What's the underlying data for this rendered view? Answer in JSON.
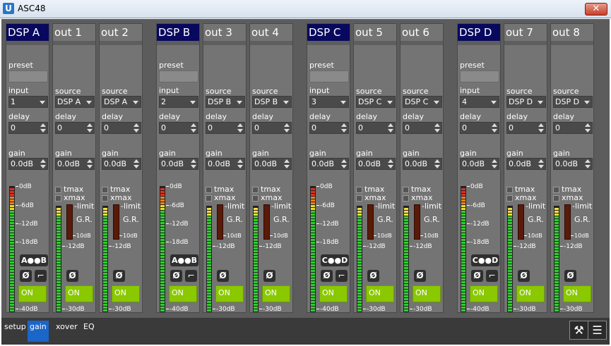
{
  "window": {
    "title": "ASC48",
    "app_icon": "U",
    "close_label": "✕"
  },
  "labels": {
    "preset": "preset",
    "input": "input",
    "source": "source",
    "delay": "delay",
    "gain": "gain",
    "tmax": "tmax",
    "xmax": "xmax",
    "limit": "-limit",
    "gr": "G.R.",
    "gr_scale": "10dB",
    "on": "ON",
    "phase": "Ø",
    "filter": "⌐"
  },
  "meter_scale_dsp": [
    "0dB",
    "-6dB",
    "-12dB",
    "-18dB",
    "-40dB"
  ],
  "meter_scale_out": [
    "-12dB",
    "-30dB"
  ],
  "groups": [
    {
      "dsp": {
        "name": "DSP A",
        "input": "1",
        "delay": "0",
        "gain": "0.0dB",
        "link": "A●●B"
      },
      "outs": [
        {
          "name": "out 1",
          "source": "DSP A",
          "delay": "0",
          "gain": "0.0dB"
        },
        {
          "name": "out 2",
          "source": "DSP A",
          "delay": "0",
          "gain": "0.0dB"
        }
      ]
    },
    {
      "dsp": {
        "name": "DSP B",
        "input": "2",
        "delay": "0",
        "gain": "0.0dB",
        "link": "A●●B"
      },
      "outs": [
        {
          "name": "out 3",
          "source": "DSP B",
          "delay": "0",
          "gain": "0.0dB"
        },
        {
          "name": "out 4",
          "source": "DSP B",
          "delay": "0",
          "gain": "0.0dB"
        }
      ]
    },
    {
      "dsp": {
        "name": "DSP C",
        "input": "3",
        "delay": "0",
        "gain": "0.0dB",
        "link": "C●●D"
      },
      "outs": [
        {
          "name": "out 5",
          "source": "DSP C",
          "delay": "0",
          "gain": "0.0dB"
        },
        {
          "name": "out 6",
          "source": "DSP C",
          "delay": "0",
          "gain": "0.0dB"
        }
      ]
    },
    {
      "dsp": {
        "name": "DSP D",
        "input": "4",
        "delay": "0",
        "gain": "0.0dB",
        "link": "C●●D"
      },
      "outs": [
        {
          "name": "out 7",
          "source": "DSP D",
          "delay": "0",
          "gain": "0.0dB"
        },
        {
          "name": "out 8",
          "source": "DSP D",
          "delay": "0",
          "gain": "0.0dB"
        }
      ]
    }
  ],
  "bottom": {
    "tabs": [
      {
        "label": "setup",
        "selected": false
      },
      {
        "label": "gain",
        "selected": true
      },
      {
        "label": "xover",
        "selected": false
      },
      {
        "label": "EQ",
        "selected": false
      }
    ],
    "tools_icon": "⚒",
    "menu_icon": "☰"
  },
  "colors": {
    "dsp_header": "#07085e",
    "on_green": "#8ac800",
    "selected_tab": "#1b66c8"
  }
}
